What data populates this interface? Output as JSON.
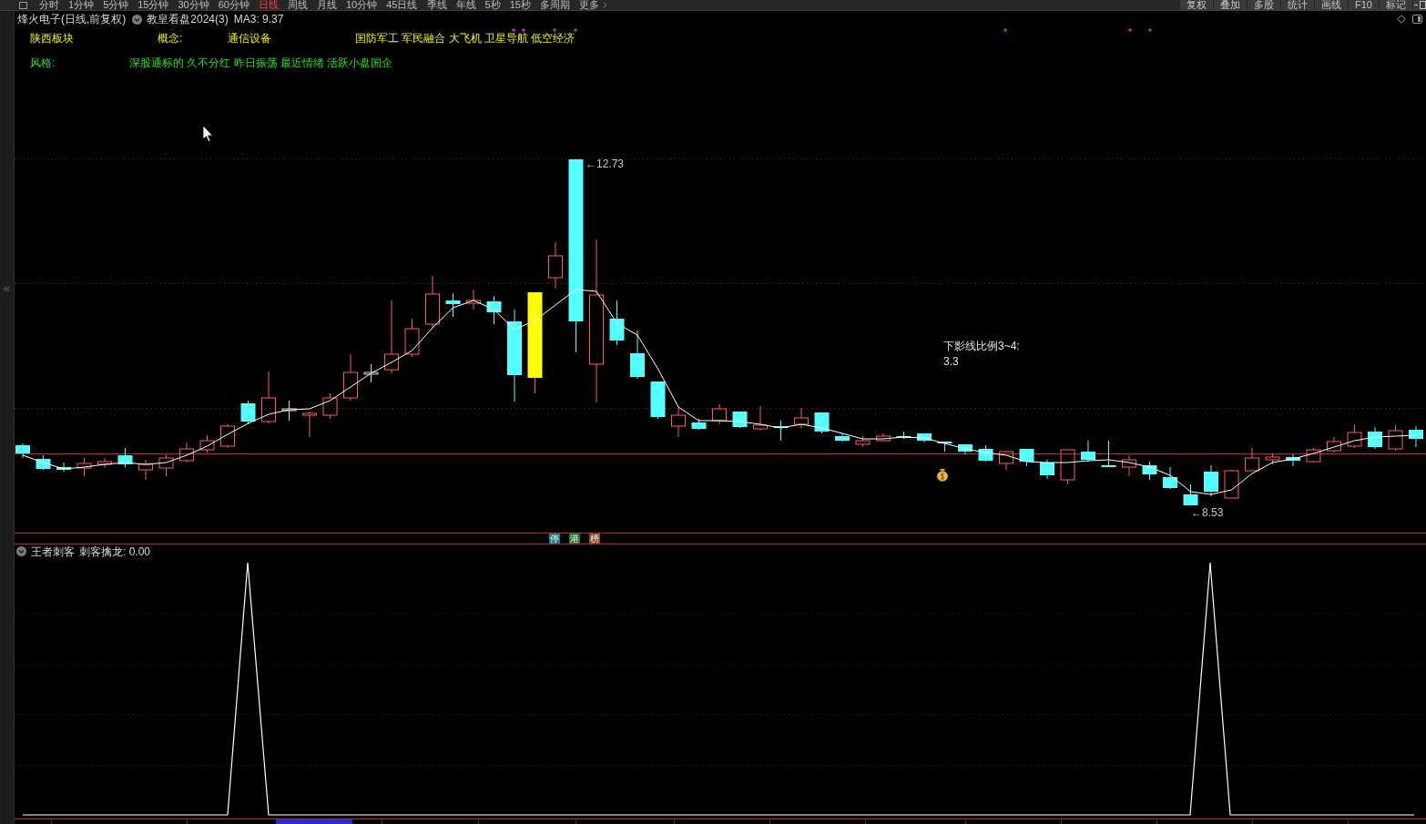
{
  "toolbar": {
    "periods": [
      {
        "label": "分时",
        "selected": false
      },
      {
        "label": "1分钟",
        "selected": false
      },
      {
        "label": "5分钟",
        "selected": false
      },
      {
        "label": "15分钟",
        "selected": false
      },
      {
        "label": "30分钟",
        "selected": false
      },
      {
        "label": "60分钟",
        "selected": false
      },
      {
        "label": "日线",
        "selected": true
      },
      {
        "label": "周线",
        "selected": false
      },
      {
        "label": "月线",
        "selected": false
      },
      {
        "label": "10分钟",
        "selected": false
      },
      {
        "label": "45日线",
        "selected": false
      },
      {
        "label": "季线",
        "selected": false
      },
      {
        "label": "年线",
        "selected": false
      },
      {
        "label": "5秒",
        "selected": false
      },
      {
        "label": "15秒",
        "selected": false
      },
      {
        "label": "多周期",
        "selected": false
      }
    ],
    "more": "更多",
    "tools": [
      "复权",
      "叠加",
      "多股",
      "统计",
      "画线",
      "F10",
      "标记"
    ]
  },
  "header": {
    "title": "烽火电子(日线,前复权)",
    "formula": "教皇看盘2024(3)",
    "ma_reading": "MA3: 9.37"
  },
  "info": {
    "region": "陕西板块",
    "concept_label": "概念:",
    "industry": "通信设备",
    "concepts": "国防军工 军民融合 大飞机 卫星导航 低空经济",
    "style_label": "风格:",
    "styles": "深股通标的 久不分红 昨日振荡 最近情绪 活跃小盘国企"
  },
  "price_chart": {
    "high_marker": "←12.73",
    "low_marker": "←8.53",
    "note_title": "下影线比例3~4:",
    "note_value": "3.3"
  },
  "badges": [
    {
      "text": "停",
      "color": "#1e7f8c"
    },
    {
      "text": "港",
      "color": "#1d7a2c"
    },
    {
      "text": "榜",
      "color": "#8c4a1c"
    }
  ],
  "indicator": {
    "name": "王者刺客",
    "reading": "刺客擒龙: 0.00"
  }
}
